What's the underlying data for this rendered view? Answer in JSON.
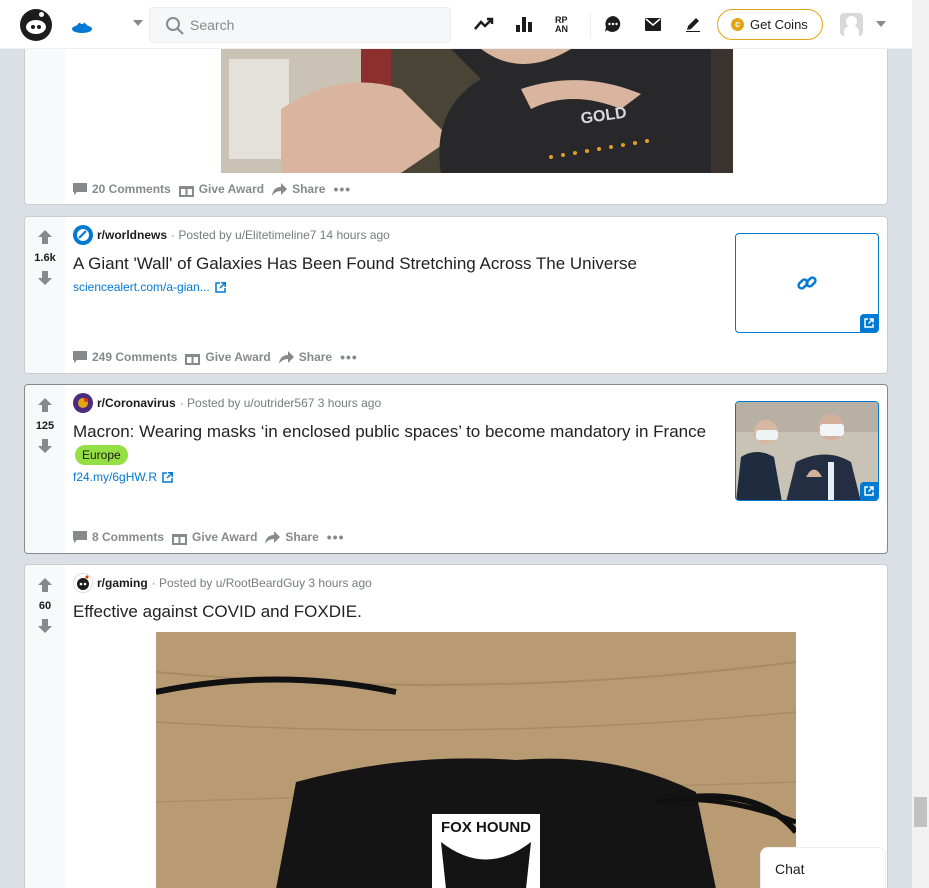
{
  "header": {
    "search_placeholder": "Search",
    "get_coins_label": "Get Coins"
  },
  "posts": [
    {
      "id": "post-top",
      "comments_label": "20 Comments",
      "award_label": "Give Award",
      "share_label": "Share"
    },
    {
      "id": "post-worldnews",
      "score": "1.6k",
      "subreddit": "r/worldnews",
      "posted_by": "· Posted by u/Elitetimeline7 14 hours ago",
      "title": "A Giant 'Wall' of Galaxies Has Been Found Stretching Across The Universe",
      "link": "sciencealert.com/a-gian...",
      "comments_label": "249 Comments",
      "award_label": "Give Award",
      "share_label": "Share"
    },
    {
      "id": "post-coronavirus",
      "score": "125",
      "subreddit": "r/Coronavirus",
      "posted_by": "· Posted by u/outrider567 3 hours ago",
      "title": "Macron: Wearing masks ‘in enclosed public spaces’ to become mandatory in France",
      "flair": "Europe",
      "link": "f24.my/6gHW.R",
      "comments_label": "8 Comments",
      "award_label": "Give Award",
      "share_label": "Share"
    },
    {
      "id": "post-gaming",
      "score": "60",
      "subreddit": "r/gaming",
      "posted_by": "· Posted by u/RootBeardGuy 3 hours ago",
      "title": "Effective against COVID and FOXDIE.",
      "image_text": "FOX HOUND"
    }
  ],
  "chat_label": "Chat",
  "colors": {
    "accent": "#0079d3",
    "coin": "#e3a612",
    "flair": "#94e044",
    "page_bg": "#dae0e6"
  }
}
